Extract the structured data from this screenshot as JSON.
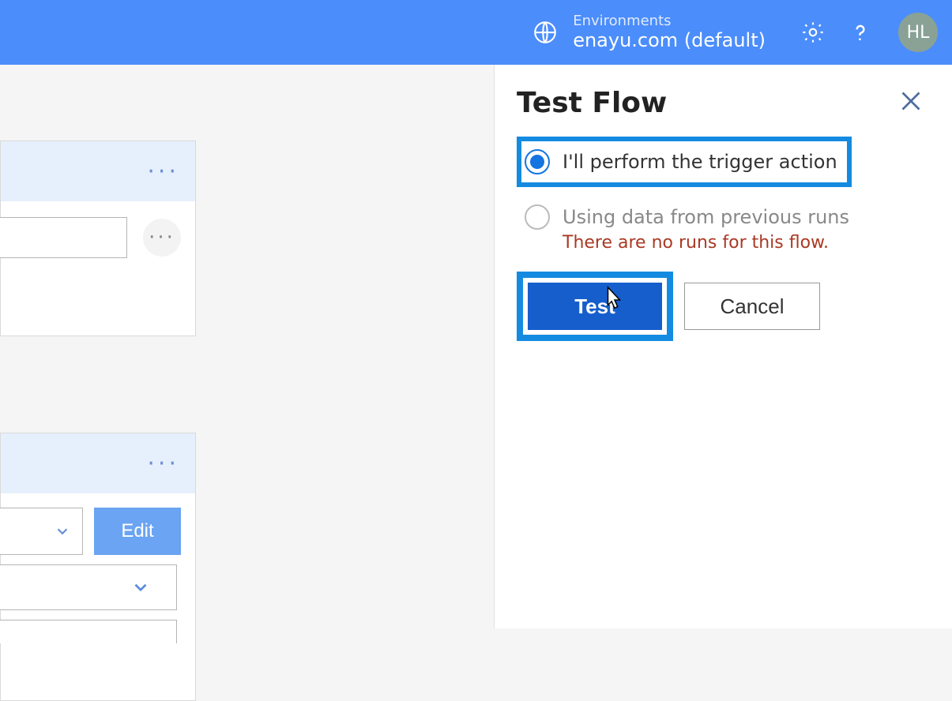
{
  "header": {
    "env_label": "Environments",
    "env_name": "enayu.com (default)",
    "avatar_initials": "HL"
  },
  "canvas": {
    "card1_more": "···",
    "card1_circle_more": "···",
    "card2_more": "···",
    "edit_button": "Edit"
  },
  "panel": {
    "title": "Test Flow",
    "option1_label": "I'll perform the trigger action",
    "option2_label": "Using data from previous runs",
    "option2_warning": "There are no runs for this flow.",
    "test_button": "Test",
    "cancel_button": "Cancel"
  }
}
